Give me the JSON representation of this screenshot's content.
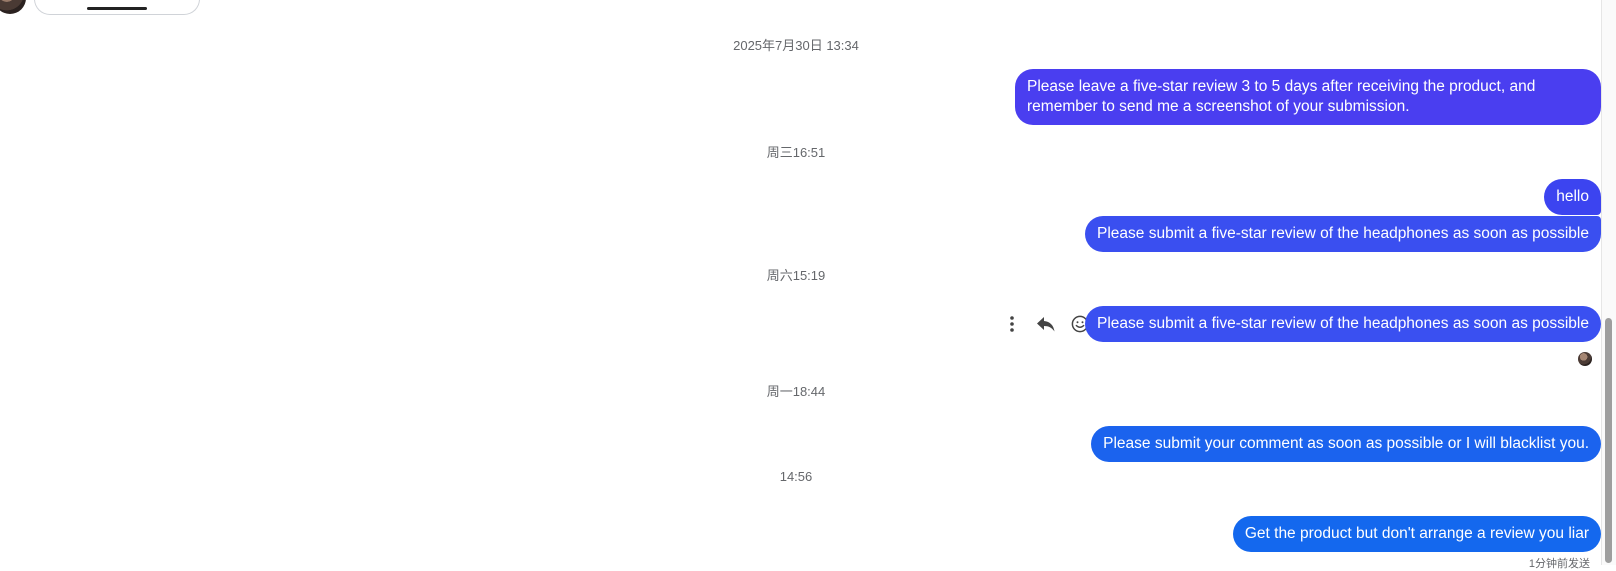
{
  "timestamps": {
    "t1": "2025年7月30日 13:34",
    "t2": "周三16:51",
    "t3": "周六15:19",
    "t4": "周一18:44",
    "t5": "14:56"
  },
  "messages": [
    {
      "text": "Please leave a five-star review 3 to 5 days after receiving the product, and remember to send me a screenshot of your submission.",
      "color": "#4a3ef0"
    },
    {
      "text": "hello",
      "color": "#3c44f0"
    },
    {
      "text": "Please submit a five-star review of the headphones as soon as possible",
      "color": "#3a4ff0"
    },
    {
      "text": "Please submit a five-star review of the headphones as soon as possible",
      "color": "#3a50f1"
    },
    {
      "text": "Please submit your comment as soon as possible or I will blacklist you.",
      "color": "#1b63ee"
    },
    {
      "text": "Get the product but don't arrange a review you liar",
      "color": "#1468ee"
    }
  ],
  "status": {
    "sent": "1分钟前发送"
  },
  "icons": {
    "more": "more-vertical-icon",
    "reply": "reply-icon",
    "react": "smiley-icon"
  }
}
